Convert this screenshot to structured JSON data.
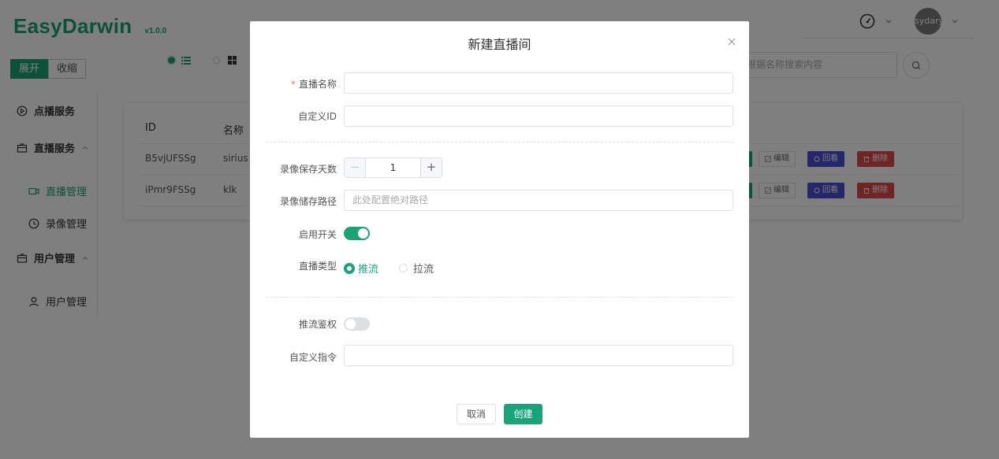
{
  "app": {
    "logo": "EasyDarwin",
    "version": "v1.0.0",
    "user": "sydary"
  },
  "toolbar": {
    "expand_label": "展开",
    "collapse_label": "收缩",
    "search_placeholder": "根据名称搜索内容"
  },
  "sidebar": {
    "items": [
      {
        "label": "点播服务",
        "icon": "play-circle-icon"
      },
      {
        "label": "直播服务",
        "icon": "folder-icon"
      },
      {
        "label": "直播管理",
        "icon": "video-icon"
      },
      {
        "label": "录像管理",
        "icon": "clock-icon"
      },
      {
        "label": "用户管理",
        "icon": "folder-icon"
      },
      {
        "label": "用户管理",
        "icon": "user-icon"
      }
    ]
  },
  "table": {
    "columns": [
      "ID",
      "名称"
    ],
    "rows": [
      {
        "id": "B5vjUFSSg",
        "name": "sirius"
      },
      {
        "id": "iPmr9FSSg",
        "name": "klk"
      }
    ],
    "actions": {
      "edit": "编辑",
      "playback": "回看",
      "delete": "删除"
    }
  },
  "modal": {
    "title": "新建直播间",
    "fields": {
      "name_label": "直播名称",
      "custom_id_label": "自定义ID",
      "save_days_label": "录像保存天数",
      "save_days_value": "1",
      "save_path_label": "录像储存路径",
      "save_path_placeholder": "此处配置绝对路径",
      "enable_label": "启用开关",
      "enable_on": true,
      "stream_type_label": "直播类型",
      "stream_type_options": [
        "推流",
        "拉流"
      ],
      "stream_type_selected": "推流",
      "auth_label": "推流鉴权",
      "auth_on": false,
      "custom_cmd_label": "自定义指令"
    },
    "cancel_label": "取消",
    "create_label": "创建"
  },
  "colors": {
    "accent": "#1aa377",
    "playback": "#4a4fd1",
    "delete": "#dc4a4a"
  }
}
